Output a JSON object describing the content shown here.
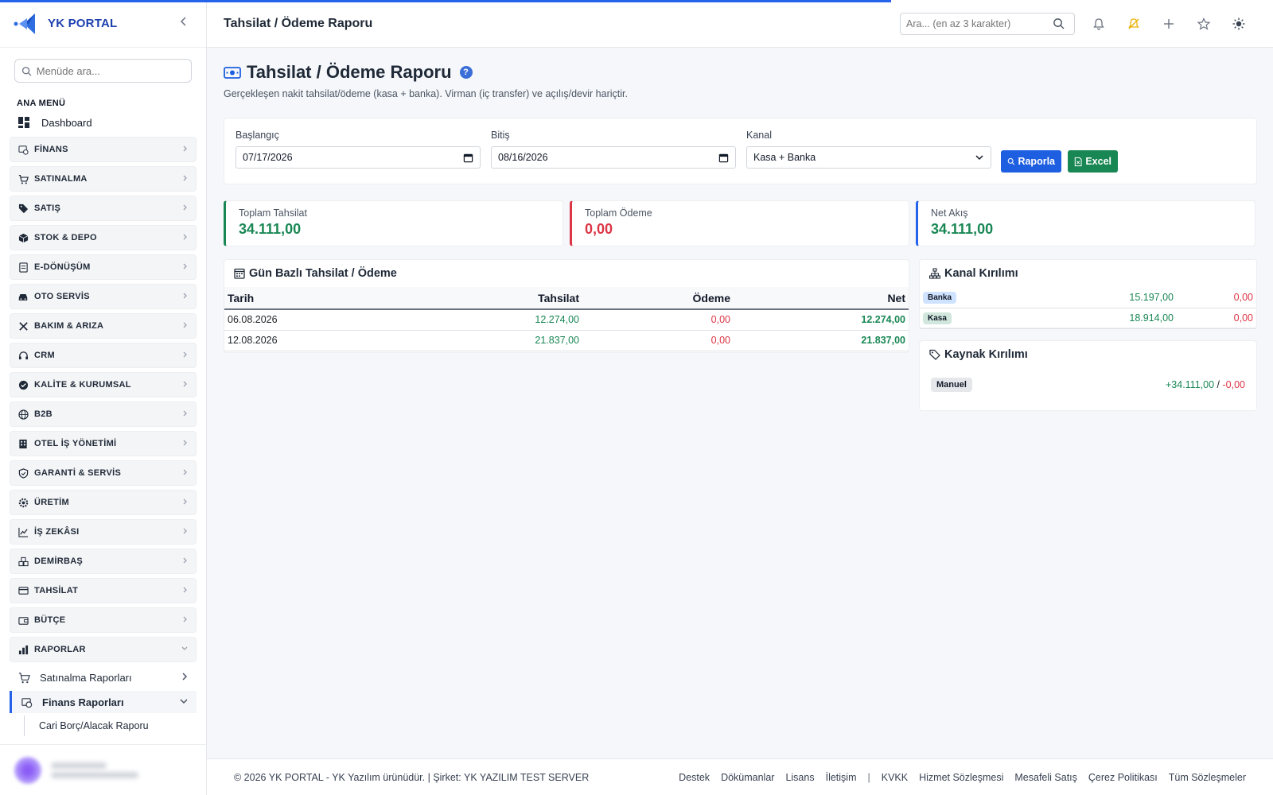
{
  "brand": {
    "name": "YK PORTAL"
  },
  "sidebar": {
    "search_placeholder": "Menüde ara...",
    "menu_heading": "ANA MENÜ",
    "dashboard_label": "Dashboard",
    "groups": [
      {
        "label": "FİNANS",
        "icon": "finance-icon"
      },
      {
        "label": "SATINALMA",
        "icon": "cart-icon"
      },
      {
        "label": "SATIŞ",
        "icon": "tag-icon"
      },
      {
        "label": "STOK & DEPO",
        "icon": "box-icon"
      },
      {
        "label": "E-DÖNÜŞÜM",
        "icon": "document-icon"
      },
      {
        "label": "OTO SERVİS",
        "icon": "car-icon"
      },
      {
        "label": "BAKIM & ARIZA",
        "icon": "tools-icon"
      },
      {
        "label": "CRM",
        "icon": "headset-icon"
      },
      {
        "label": "KALİTE & KURUMSAL",
        "icon": "badge-check-icon"
      },
      {
        "label": "B2B",
        "icon": "globe-icon"
      },
      {
        "label": "OTEL İŞ YÖNETİMİ",
        "icon": "building-icon"
      },
      {
        "label": "GARANTİ & SERVİS",
        "icon": "shield-icon"
      },
      {
        "label": "ÜRETİM",
        "icon": "gear-icon"
      },
      {
        "label": "İŞ ZEKÂSI",
        "icon": "graph-up-icon"
      },
      {
        "label": "DEMİRBAŞ",
        "icon": "boxes-icon"
      },
      {
        "label": "TAHSİLAT",
        "icon": "credit-card-icon"
      },
      {
        "label": "BÜTÇE",
        "icon": "wallet-icon"
      },
      {
        "label": "RAPORLAR",
        "icon": "bar-chart-icon"
      }
    ],
    "sub_items": [
      {
        "label": "Satınalma Raporları"
      },
      {
        "label": "Finans Raporları"
      }
    ],
    "leaf_label": "Cari Borç/Alacak Raporu"
  },
  "topbar": {
    "title": "Tahsilat / Ödeme Raporu",
    "search_placeholder": "Ara... (en az 3 karakter)"
  },
  "page": {
    "title": "Tahsilat / Ödeme Raporu",
    "help": "?",
    "subtitle": "Gerçekleşen nakit tahsilat/ödeme (kasa + banka). Virman (iç transfer) ve açılış/devir hariçtir."
  },
  "filters": {
    "start_label": "Başlangıç",
    "start_value": "07/17/2026",
    "end_label": "Bitiş",
    "end_value": "08/16/2026",
    "channel_label": "Kanal",
    "channel_value": "Kasa + Banka",
    "report_button": "Raporla",
    "excel_button": "Excel"
  },
  "kpis": [
    {
      "label": "Toplam Tahsilat",
      "value": "34.111,00"
    },
    {
      "label": "Toplam Ödeme",
      "value": "0,00"
    },
    {
      "label": "Net Akış",
      "value": "34.111,00"
    }
  ],
  "daily": {
    "title": "Gün Bazlı Tahsilat / Ödeme",
    "columns": [
      "Tarih",
      "Tahsilat",
      "Ödeme",
      "Net"
    ],
    "rows": [
      {
        "date": "06.08.2026",
        "in": "12.274,00",
        "out": "0,00",
        "net": "12.274,00"
      },
      {
        "date": "12.08.2026",
        "in": "21.837,00",
        "out": "0,00",
        "net": "21.837,00"
      }
    ]
  },
  "channels": {
    "title": "Kanal Kırılımı",
    "rows": [
      {
        "name": "Banka",
        "in": "15.197,00",
        "out": "0,00"
      },
      {
        "name": "Kasa",
        "in": "18.914,00",
        "out": "0,00"
      }
    ]
  },
  "sources": {
    "title": "Kaynak Kırılımı",
    "rows": [
      {
        "name": "Manuel",
        "in": "+34.111,00",
        "sep": "/",
        "out": "-0,00"
      }
    ]
  },
  "footer": {
    "copyright": "© 2026 YK PORTAL - YK Yazılım ürünüdür. | Şirket: YK YAZILIM TEST SERVER",
    "links": [
      "Destek",
      "Dökümanlar",
      "Lisans",
      "İletişim"
    ],
    "separator": "|",
    "legal_links": [
      "KVKK",
      "Hizmet Sözleşmesi",
      "Mesafeli Satış",
      "Çerez Politikası",
      "Tüm Sözleşmeler"
    ]
  },
  "colors": {
    "accent": "#2563eb",
    "success": "#198754",
    "danger": "#dc3545",
    "kpi_border_in": "#198754",
    "kpi_border_out": "#dc3545",
    "kpi_border_net": "#2563eb"
  }
}
